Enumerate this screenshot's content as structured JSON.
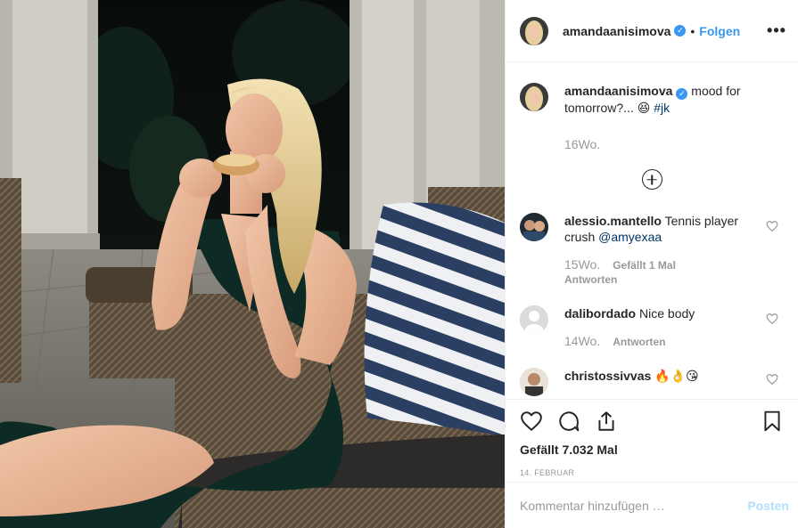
{
  "post": {
    "username": "amandaanisimova",
    "verified_mark": "✓",
    "dot": "•",
    "follow_label": "Folgen",
    "more_label": "•••",
    "photo_icon": "post-photo",
    "caption": {
      "username": "amandaanisimova",
      "text": "mood for tomorrow?... 😆",
      "hashtag": "#jk",
      "time": "16Wo."
    }
  },
  "comments": [
    {
      "username": "alessio.mantello",
      "text": "Tennis player crush",
      "mention": "@amyexaa",
      "time": "15Wo.",
      "likes": "Gefällt 1 Mal",
      "reply": "Antworten"
    },
    {
      "username": "dalibordado",
      "text": "Nice body",
      "time": "14Wo.",
      "reply": "Antworten"
    },
    {
      "username": "christossivvas",
      "text": "🔥👌😘"
    }
  ],
  "actions": {
    "likes_text": "Gefällt 7.032 Mal",
    "date": "14. FEBRUAR"
  },
  "add_comment": {
    "placeholder": "Kommentar hinzufügen …",
    "post_label": "Posten"
  },
  "colors": {
    "accent": "#3897f0",
    "link": "#003569",
    "muted": "#999999",
    "post_disabled": "#b2dffc"
  }
}
